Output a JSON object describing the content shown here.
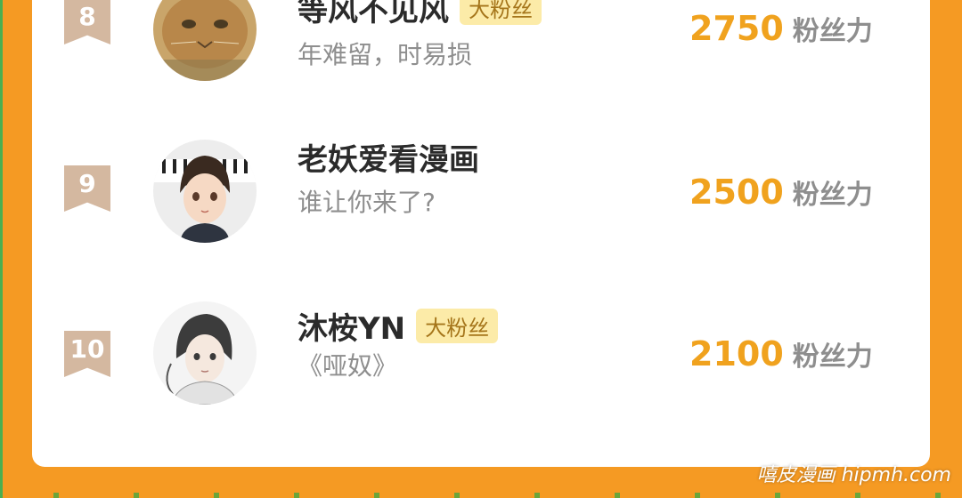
{
  "ranking": [
    {
      "rank": "8",
      "name": "等风不见风",
      "badge": "大粉丝",
      "subtitle": "年难留，时易损",
      "score": "2750",
      "score_unit": "粉丝力",
      "avatar": "cat-photo"
    },
    {
      "rank": "9",
      "name": "老妖爱看漫画",
      "badge": "",
      "subtitle": "谁让你来了?",
      "score": "2500",
      "score_unit": "粉丝力",
      "avatar": "anime-girl-keyboard"
    },
    {
      "rank": "10",
      "name": "沐桉YN",
      "badge": "大粉丝",
      "subtitle": "《哑奴》",
      "score": "2100",
      "score_unit": "粉丝力",
      "avatar": "anime-boy-sketch"
    }
  ],
  "watermark": "嘻皮漫画 hipmh.com",
  "colors": {
    "background": "#F59A23",
    "card": "#FFFFFF",
    "score": "#F0A21E",
    "badge_bg": "#FCEBA8",
    "rank_ribbon": "#D4B8A0"
  }
}
